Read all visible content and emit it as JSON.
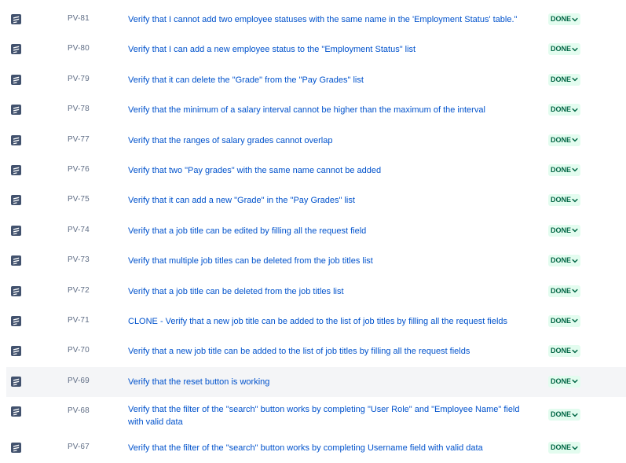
{
  "issues": [
    {
      "key": "PV-81",
      "summary": "Verify that I cannot add two employee statuses with the same name in the 'Employment Status' table.\"",
      "status": "DONE",
      "tall": false,
      "hovered": false
    },
    {
      "key": "PV-80",
      "summary": "Verify that I can add a new employee status to the \"Employment Status\" list",
      "status": "DONE",
      "tall": false,
      "hovered": false
    },
    {
      "key": "PV-79",
      "summary": "Verify that it can delete the \"Grade\" from the \"Pay Grades\" list",
      "status": "DONE",
      "tall": false,
      "hovered": false
    },
    {
      "key": "PV-78",
      "summary": "Verify that the minimum of a salary interval cannot be higher than the maximum of the interval",
      "status": "DONE",
      "tall": false,
      "hovered": false
    },
    {
      "key": "PV-77",
      "summary": "Verify that the ranges of salary grades cannot overlap",
      "status": "DONE",
      "tall": false,
      "hovered": false
    },
    {
      "key": "PV-76",
      "summary": "Verify that two \"Pay grades\" with the same name cannot be added",
      "status": "DONE",
      "tall": false,
      "hovered": false
    },
    {
      "key": "PV-75",
      "summary": "Verify that it can add a new \"Grade\" in the \"Pay Grades\" list",
      "status": "DONE",
      "tall": false,
      "hovered": false
    },
    {
      "key": "PV-74",
      "summary": "Verify that a job title can be edited by filling all the request field",
      "status": "DONE",
      "tall": false,
      "hovered": false
    },
    {
      "key": "PV-73",
      "summary": "Verify that multiple job titles can be deleted from the job titles list",
      "status": "DONE",
      "tall": false,
      "hovered": false
    },
    {
      "key": "PV-72",
      "summary": "Verify that a job title can be deleted from the job titles list",
      "status": "DONE",
      "tall": false,
      "hovered": false
    },
    {
      "key": "PV-71",
      "summary": "CLONE - Verify that a new job title can be added to the list of job titles by filling all the request fields",
      "status": "DONE",
      "tall": false,
      "hovered": false
    },
    {
      "key": "PV-70",
      "summary": "Verify that a new job title can be added to the list of job titles by filling all the request fields",
      "status": "DONE",
      "tall": false,
      "hovered": false
    },
    {
      "key": "PV-69",
      "summary": "Verify that the reset button is working",
      "status": "DONE",
      "tall": false,
      "hovered": true
    },
    {
      "key": "PV-68",
      "summary": "Verify that the filter of the \"search\" button works by completing \"User Role\" and \"Employee Name\" field with valid data",
      "status": "DONE",
      "tall": true,
      "hovered": false
    },
    {
      "key": "PV-67",
      "summary": "Verify that the filter of the \"search\" button works by completing Username field with valid data",
      "status": "DONE",
      "tall": false,
      "hovered": false
    }
  ],
  "icons": {
    "issue_type": "test-issue-icon",
    "status_chevron": "chevron-down-icon"
  },
  "colors": {
    "link": "#0052cc",
    "key": "#5e6c84",
    "status_bg": "#e3fcef",
    "status_text": "#006644",
    "icon": "#42526e",
    "hover_bg": "#f4f5f7"
  }
}
